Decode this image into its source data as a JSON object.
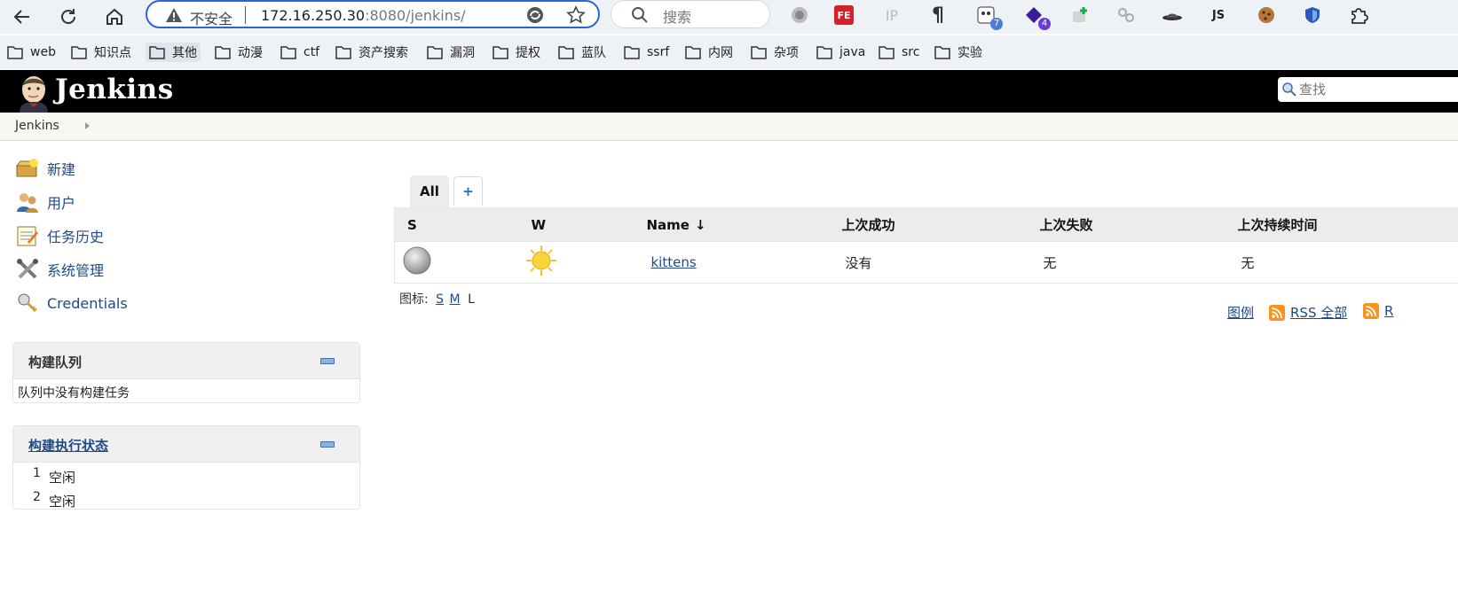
{
  "browser": {
    "address": {
      "security_label": "不安全",
      "host": "172.16.250.30",
      "rest": ":8080/jenkins/"
    },
    "search_placeholder": "搜索",
    "extensions": [
      {
        "name": "circle-extension-icon",
        "text": ""
      },
      {
        "name": "fe-extension-icon",
        "text": "FE"
      },
      {
        "name": "ip-extension-icon",
        "text": "IP"
      },
      {
        "name": "pilcrow-extension-icon",
        "text": "¶"
      },
      {
        "name": "panda-extension-icon",
        "text": "",
        "badge": "7"
      },
      {
        "name": "diamond-extension-icon",
        "text": "",
        "badge": "4"
      },
      {
        "name": "plus-extension-icon",
        "text": ""
      },
      {
        "name": "nodes-extension-icon",
        "text": ""
      },
      {
        "name": "hat-extension-icon",
        "text": ""
      },
      {
        "name": "js-extension-icon",
        "text": "JS"
      },
      {
        "name": "cookie-extension-icon",
        "text": ""
      },
      {
        "name": "shield-extension-icon",
        "text": ""
      },
      {
        "name": "puzzle-extension-icon",
        "text": ""
      }
    ],
    "bookmarks": [
      "web",
      "知识点",
      "其他",
      "动漫",
      "ctf",
      "资产搜索",
      "漏洞",
      "提权",
      "蓝队",
      "ssrf",
      "内网",
      "杂项",
      "java",
      "src",
      "实验"
    ]
  },
  "jenkins": {
    "title": "Jenkins",
    "search_placeholder": "查找",
    "breadcrumb": "Jenkins",
    "tasks": [
      "新建",
      "用户",
      "任务历史",
      "系统管理",
      "Credentials"
    ],
    "build_queue": {
      "title": "构建队列",
      "empty_text": "队列中没有构建任务"
    },
    "executors": {
      "title": "构建执行状态",
      "rows": [
        {
          "num": "1",
          "status": "空闲"
        },
        {
          "num": "2",
          "status": "空闲"
        }
      ]
    },
    "views": {
      "active_tab": "All",
      "add_tab": "+"
    },
    "table": {
      "headers": {
        "s": "S",
        "w": "W",
        "name": "Name",
        "sort_arrow": "↓",
        "last_success": "上次成功",
        "last_failure": "上次失败",
        "last_duration": "上次持续时间"
      },
      "rows": [
        {
          "name": "kittens",
          "last_success": "没有",
          "last_failure": "无",
          "last_duration": "无"
        }
      ]
    },
    "icon_size": {
      "label": "图标:",
      "s": "S",
      "m": "M",
      "l": "L"
    },
    "footer_links": {
      "legend": "图例",
      "rss_all": "RSS 全部",
      "rss_partial": "R"
    }
  }
}
